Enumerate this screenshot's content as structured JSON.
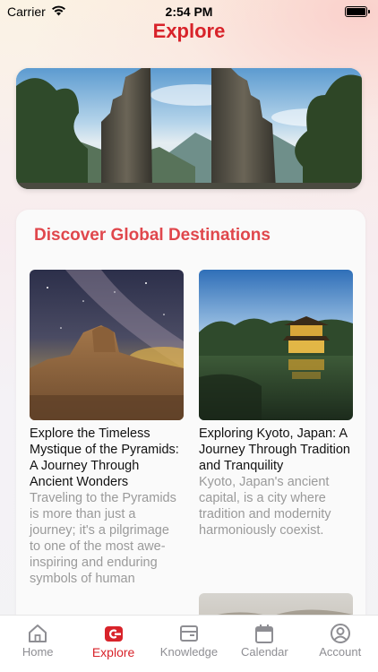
{
  "status_bar": {
    "carrier": "Carrier",
    "time": "2:54 PM"
  },
  "header": {
    "title": "Explore"
  },
  "section": {
    "title": "Discover Global Destinations"
  },
  "articles": [
    {
      "title": "Explore the Timeless Mystique of the Pyramids: A Journey Through Ancient Wonders",
      "description": "Traveling to the Pyramids is more than just a journey; it's a pilgrimage to one of the most awe-inspiring and enduring symbols of human"
    },
    {
      "title": "Exploring Kyoto, Japan: A Journey Through Tradition and Tranquility",
      "description": "Kyoto, Japan's ancient capital, is a city where tradition and modernity harmoniously coexist."
    }
  ],
  "tab_bar": {
    "items": [
      {
        "label": "Home",
        "icon": "home-icon",
        "active": false
      },
      {
        "label": "Explore",
        "icon": "explore-icon",
        "active": true
      },
      {
        "label": "Knowledge",
        "icon": "knowledge-icon",
        "active": false
      },
      {
        "label": "Calendar",
        "icon": "calendar-icon",
        "active": false
      },
      {
        "label": "Account",
        "icon": "account-icon",
        "active": false
      }
    ]
  },
  "colors": {
    "accent": "#d8232a",
    "section_title": "#e0474c",
    "inactive_tab": "#8e8e93",
    "description_text": "#9a9a9a"
  }
}
